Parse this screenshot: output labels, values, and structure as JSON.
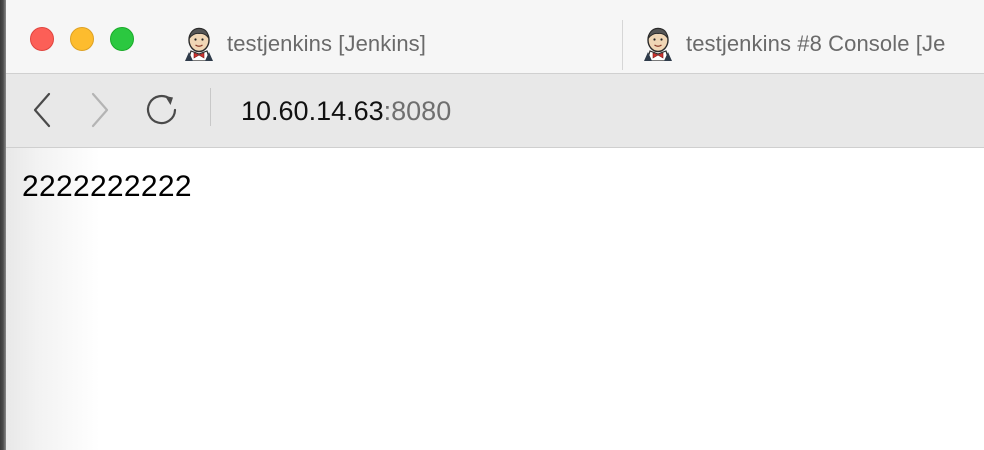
{
  "browser": {
    "window_controls": [
      "close",
      "minimize",
      "zoom"
    ],
    "tabs": [
      {
        "title": "testjenkins [Jenkins]",
        "icon": "jenkins-icon",
        "active": false
      },
      {
        "title": "testjenkins #8 Console [Je",
        "icon": "jenkins-icon",
        "active": false
      }
    ],
    "toolbar": {
      "back_icon": "chevron-left-icon",
      "forward_icon": "chevron-right-icon",
      "reload_icon": "reload-icon",
      "url_host": "10.60.14.63",
      "url_port": ":8080"
    }
  },
  "page": {
    "body_text": "2222222222"
  },
  "colors": {
    "close": "#fc5f57",
    "minimize": "#fdbc2e",
    "zoom": "#2bc840",
    "tabbar_bg": "#f6f6f6",
    "toolbar_bg": "#e8e8e8"
  }
}
